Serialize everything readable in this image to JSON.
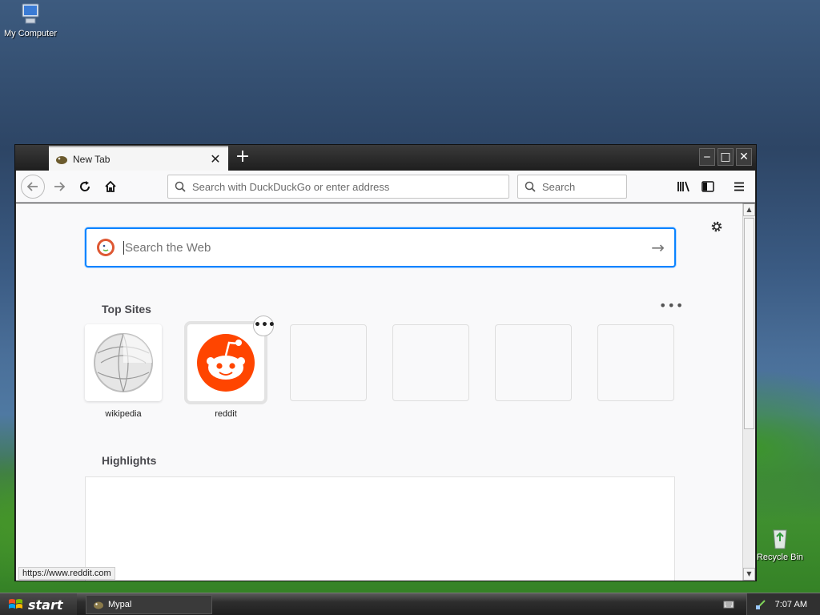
{
  "desktop": {
    "icons": [
      {
        "label": "My Computer"
      },
      {
        "label": "Recycle Bin"
      }
    ]
  },
  "browser": {
    "tab_title": "New Tab",
    "address_placeholder": "Search with DuckDuckGo or enter address",
    "search_placeholder": "Search",
    "page": {
      "web_search_placeholder": "Search the Web",
      "top_sites_title": "Top Sites",
      "top_sites": [
        {
          "label": "wikipedia"
        },
        {
          "label": "reddit"
        }
      ],
      "highlights_title": "Highlights"
    },
    "status_url": "https://www.reddit.com"
  },
  "taskbar": {
    "start_label": "start",
    "window_button_label": "Mypal",
    "clock": "7:07 AM"
  },
  "colors": {
    "accent": "#0a84ff",
    "reddit": "#ff4500"
  }
}
